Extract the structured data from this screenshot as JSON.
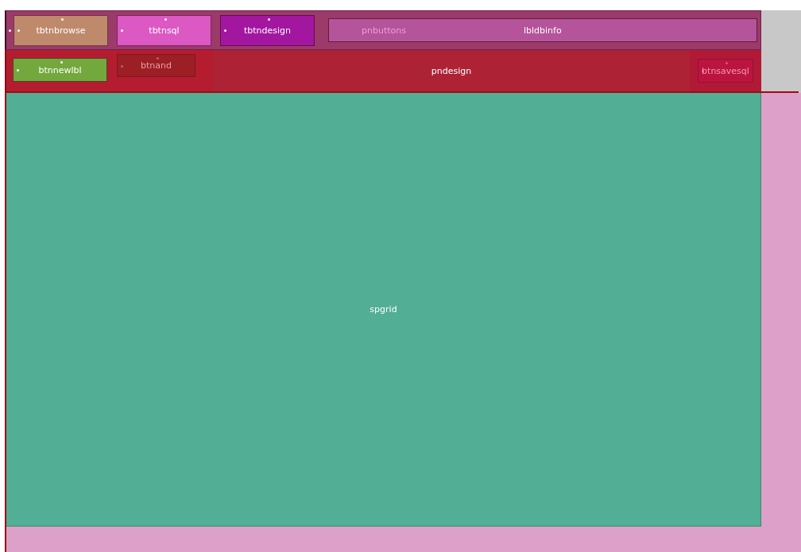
{
  "toolbar": {
    "buttons": [
      {
        "label": "tbtnbrowse",
        "color": "#bf8a6c"
      },
      {
        "label": "tbtnsql",
        "color": "#dc58c2"
      },
      {
        "label": "tbtndesign",
        "color": "#a317a0"
      }
    ],
    "panel_label": "pnbuttons",
    "info_label": "lbldbinfo"
  },
  "design_panel": {
    "label": "pndesign",
    "buttons": [
      {
        "label": "btnnewlbl",
        "color": "#73a83c",
        "disabled": false
      },
      {
        "label": "btnand",
        "color": "#9c1f26",
        "disabled": true
      }
    ],
    "save_button": {
      "label": "btnsavesql",
      "disabled": true
    }
  },
  "grid": {
    "label": "spgrid"
  }
}
